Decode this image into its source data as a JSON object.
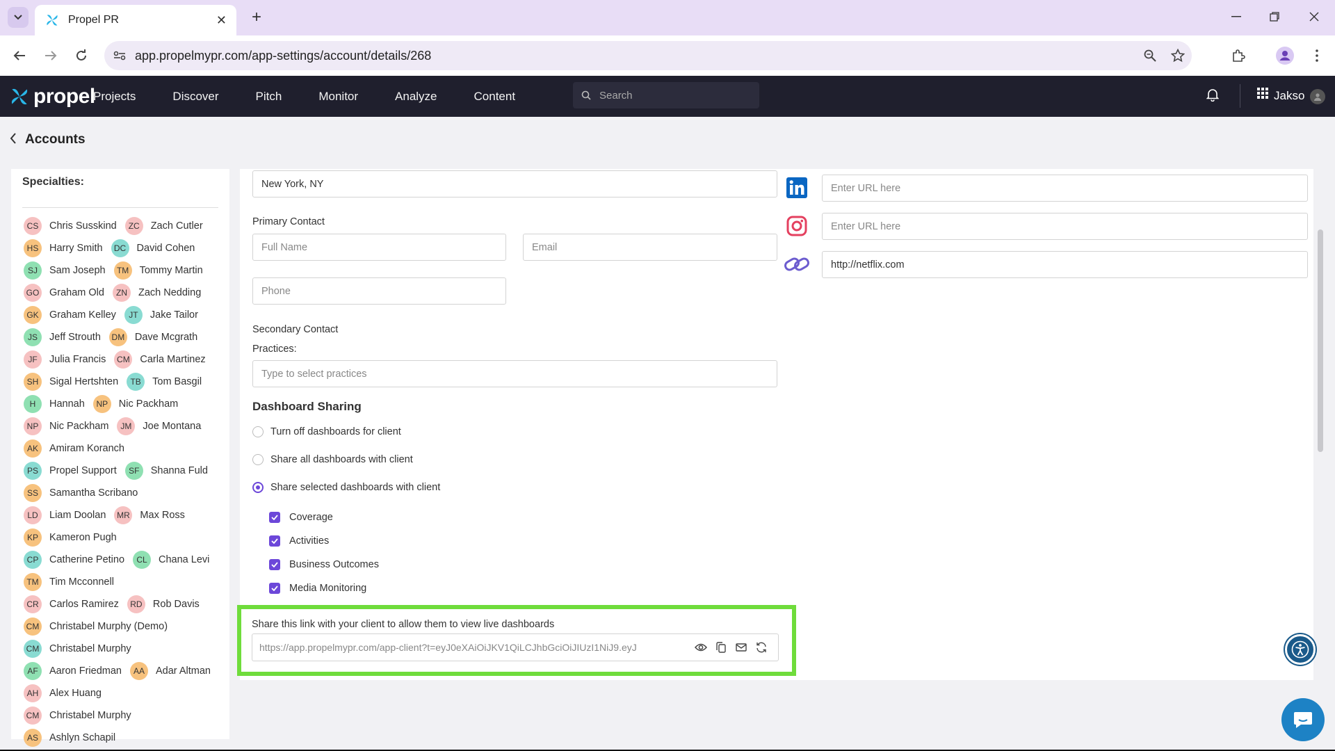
{
  "browser": {
    "tab_title": "Propel PR",
    "url": "app.propelmypr.com/app-settings/account/details/268"
  },
  "app": {
    "logo_text": "propel",
    "nav": [
      "Projects",
      "Discover",
      "Pitch",
      "Monitor",
      "Analyze",
      "Content"
    ],
    "search_placeholder": "Search",
    "user_name": "Jakso"
  },
  "page": {
    "title": "Accounts"
  },
  "left_panel": {
    "specialties_label": "Specialties:",
    "team_rows": [
      [
        {
          "initials": "CS",
          "name": "Chris Susskind",
          "color": "pink"
        },
        {
          "initials": "ZC",
          "name": "Zach Cutler",
          "color": "pink"
        }
      ],
      [
        {
          "initials": "HS",
          "name": "Harry Smith",
          "color": "orange"
        },
        {
          "initials": "DC",
          "name": "David Cohen",
          "color": "teal"
        }
      ],
      [
        {
          "initials": "SJ",
          "name": "Sam Joseph",
          "color": "green"
        },
        {
          "initials": "TM",
          "name": "Tommy Martin",
          "color": "orange"
        }
      ],
      [
        {
          "initials": "GO",
          "name": "Graham Old",
          "color": "pink"
        },
        {
          "initials": "ZN",
          "name": "Zach Nedding",
          "color": "pink"
        }
      ],
      [
        {
          "initials": "GK",
          "name": "Graham Kelley",
          "color": "orange"
        },
        {
          "initials": "JT",
          "name": "Jake Tailor",
          "color": "teal"
        }
      ],
      [
        {
          "initials": "JS",
          "name": "Jeff Strouth",
          "color": "green"
        },
        {
          "initials": "DM",
          "name": "Dave Mcgrath",
          "color": "orange"
        }
      ],
      [
        {
          "initials": "JF",
          "name": "Julia Francis",
          "color": "pink"
        },
        {
          "initials": "CM",
          "name": "Carla Martinez",
          "color": "pink"
        }
      ],
      [
        {
          "initials": "SH",
          "name": "Sigal Hertshten",
          "color": "orange"
        },
        {
          "initials": "TB",
          "name": "Tom Basgil",
          "color": "teal"
        }
      ],
      [
        {
          "initials": "H",
          "name": "Hannah",
          "color": "green"
        },
        {
          "initials": "NP",
          "name": "Nic Packham",
          "color": "orange"
        }
      ],
      [
        {
          "initials": "NP",
          "name": "Nic Packham",
          "color": "pink"
        },
        {
          "initials": "JM",
          "name": "Joe Montana",
          "color": "pink"
        }
      ],
      [
        {
          "initials": "AK",
          "name": "Amiram Koranch",
          "color": "orange"
        }
      ],
      [
        {
          "initials": "PS",
          "name": "Propel Support",
          "color": "teal"
        },
        {
          "initials": "SF",
          "name": "Shanna Fuld",
          "color": "green"
        }
      ],
      [
        {
          "initials": "SS",
          "name": "Samantha Scribano",
          "color": "orange"
        }
      ],
      [
        {
          "initials": "LD",
          "name": "Liam Doolan",
          "color": "pink"
        },
        {
          "initials": "MR",
          "name": "Max Ross",
          "color": "pink"
        }
      ],
      [
        {
          "initials": "KP",
          "name": "Kameron Pugh",
          "color": "orange"
        }
      ],
      [
        {
          "initials": "CP",
          "name": "Catherine Petino",
          "color": "teal"
        },
        {
          "initials": "CL",
          "name": "Chana Levi",
          "color": "green"
        }
      ],
      [
        {
          "initials": "TM",
          "name": "Tim Mcconnell",
          "color": "orange"
        }
      ],
      [
        {
          "initials": "CR",
          "name": "Carlos Ramirez",
          "color": "pink"
        },
        {
          "initials": "RD",
          "name": "Rob Davis",
          "color": "pink"
        }
      ],
      [
        {
          "initials": "CM",
          "name": "Christabel Murphy (Demo)",
          "color": "orange"
        }
      ],
      [
        {
          "initials": "CM",
          "name": "Christabel Murphy",
          "color": "teal"
        }
      ],
      [
        {
          "initials": "AF",
          "name": "Aaron Friedman",
          "color": "green"
        },
        {
          "initials": "AA",
          "name": "Adar Altman",
          "color": "orange"
        }
      ],
      [
        {
          "initials": "AH",
          "name": "Alex Huang",
          "color": "pink"
        }
      ],
      [
        {
          "initials": "CM",
          "name": "Christabel Murphy",
          "color": "pink"
        }
      ],
      [
        {
          "initials": "AS",
          "name": "Ashlyn Schapil",
          "color": "orange"
        }
      ]
    ]
  },
  "form": {
    "location_value": "New York, NY",
    "primary_contact_label": "Primary Contact",
    "full_name_placeholder": "Full Name",
    "email_placeholder": "Email",
    "phone_placeholder": "Phone",
    "secondary_contact_label": "Secondary Contact",
    "practices_label": "Practices:",
    "practices_placeholder": "Type to select practices",
    "linkedin_placeholder": "Enter URL here",
    "instagram_placeholder": "Enter URL here",
    "website_value": "http://netflix.com"
  },
  "dashboard_sharing": {
    "title": "Dashboard Sharing",
    "options": [
      {
        "label": "Turn off dashboards for client",
        "selected": false
      },
      {
        "label": "Share all dashboards with client",
        "selected": false
      },
      {
        "label": "Share selected dashboards with client",
        "selected": true
      }
    ],
    "dashboards": [
      {
        "label": "Coverage",
        "checked": true
      },
      {
        "label": "Activities",
        "checked": true
      },
      {
        "label": "Business Outcomes",
        "checked": true
      },
      {
        "label": "Media Monitoring",
        "checked": true
      }
    ],
    "share_label": "Share this link with your client to allow them to view live dashboards",
    "share_url": "https://app.propelmypr.com/app-client?t=eyJ0eXAiOiJKV1QiLCJhbGciOiJIUzI1NiJ9.eyJ"
  },
  "colors": {
    "accent": "#6c47d9",
    "highlight_border": "#6fdc3b",
    "app_header": "#1f1f2d"
  }
}
